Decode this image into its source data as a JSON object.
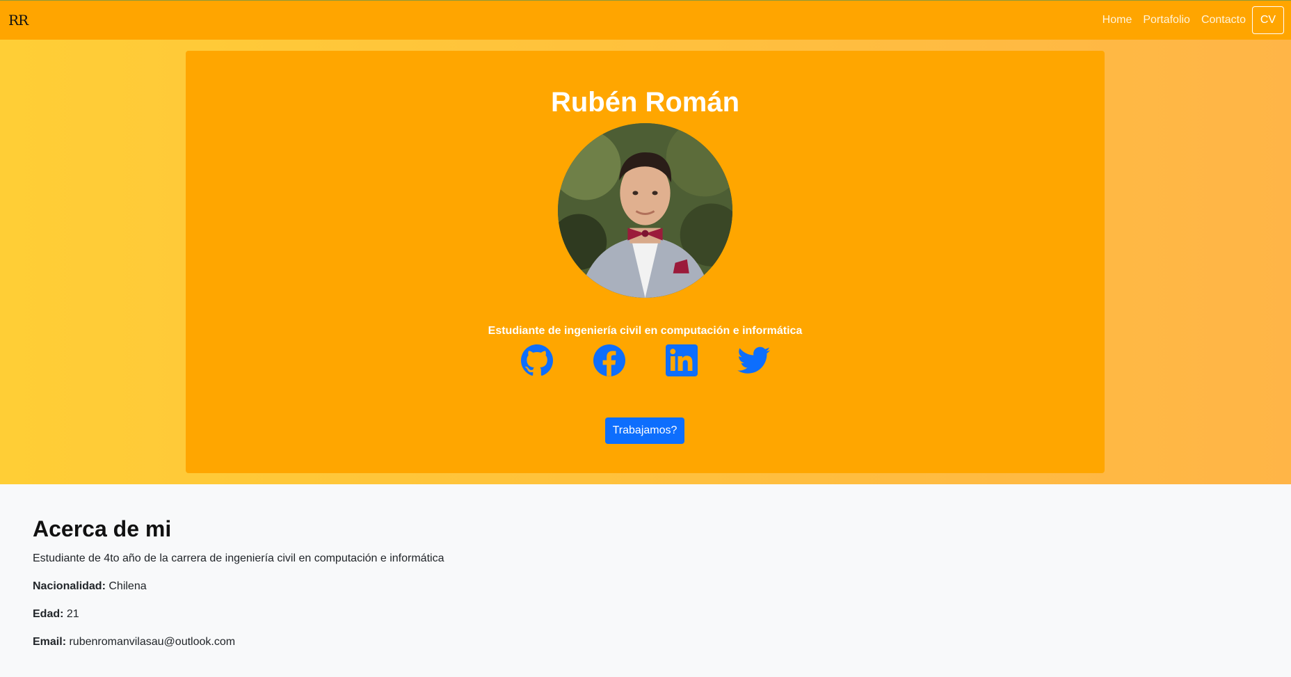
{
  "navbar": {
    "brand": "RR",
    "links": [
      "Home",
      "Portafolio",
      "Contacto"
    ],
    "cv_label": "CV"
  },
  "hero": {
    "title": "Rubén Román",
    "subtitle": "Estudiante de ingeniería civil en computación e informática",
    "socials": [
      "github-icon",
      "facebook-icon",
      "linkedin-icon",
      "twitter-icon"
    ],
    "cta_label": "Trabajamos?"
  },
  "about": {
    "heading": "Acerca de mi",
    "description": "Estudiante de 4to año de la carrera de ingeniería civil en computación e informática",
    "nationality_label": "Nacionalidad:",
    "nationality_value": "Chilena",
    "age_label": "Edad:",
    "age_value": "21",
    "email_label": "Email:",
    "email_value": "rubenromanvilasau@outlook.com"
  },
  "colors": {
    "navbar": "#ffa500",
    "card": "#ffa600",
    "accent": "#0d6efd"
  }
}
